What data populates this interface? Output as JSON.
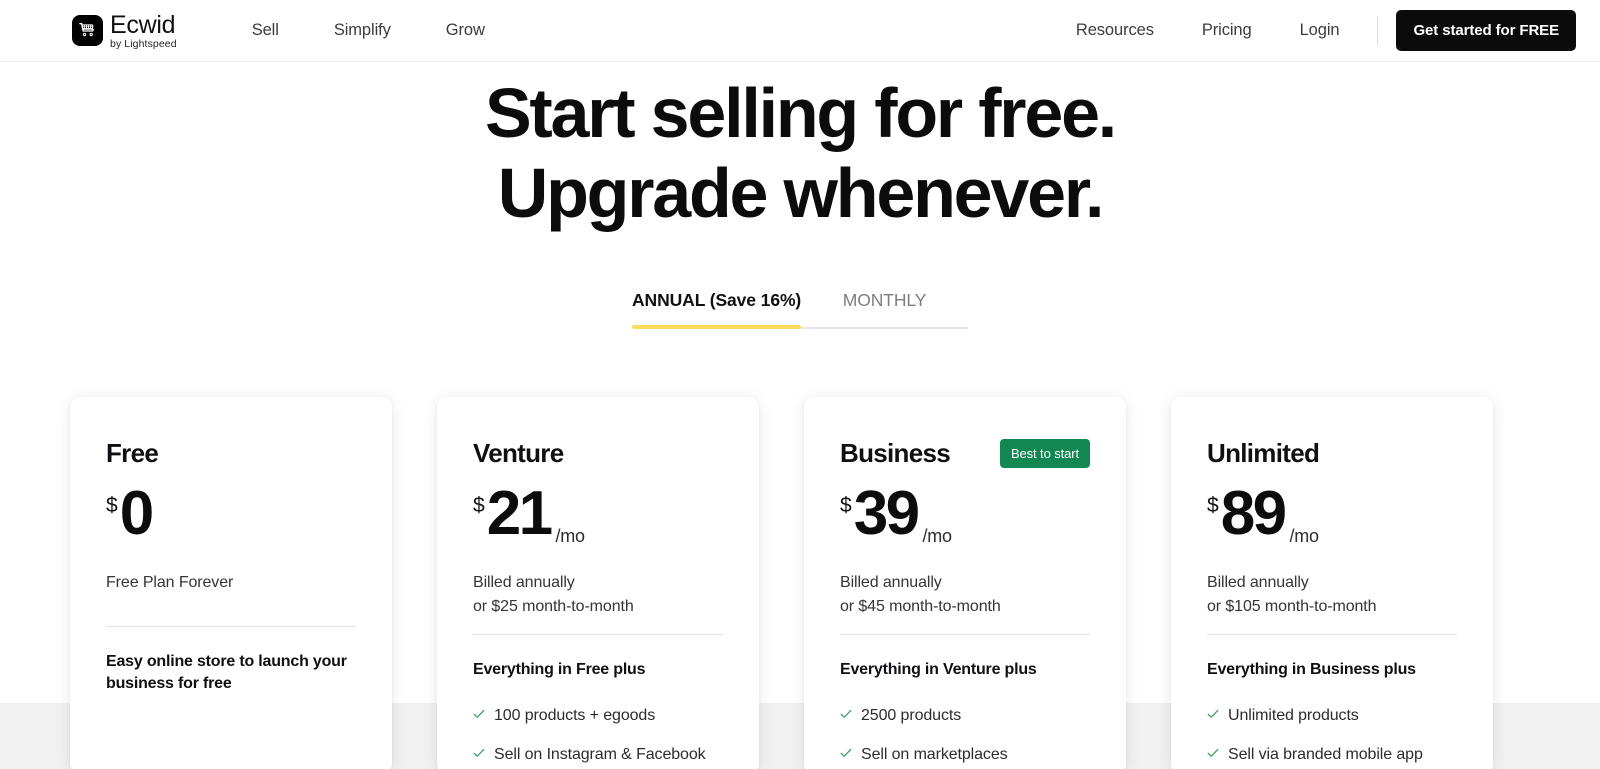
{
  "header": {
    "brand": {
      "icon": "shopping-cart-icon",
      "name": "Ecwid",
      "tagline": "by Lightspeed"
    },
    "nav_primary": [
      {
        "label": "Sell"
      },
      {
        "label": "Simplify"
      },
      {
        "label": "Grow"
      }
    ],
    "nav_right": [
      {
        "label": "Resources"
      },
      {
        "label": "Pricing"
      },
      {
        "label": "Login"
      }
    ],
    "cta_label": "Get started for FREE"
  },
  "hero": {
    "title_line1": "Start selling for free.",
    "title_line2": "Upgrade whenever."
  },
  "billing_toggle": {
    "tabs": [
      {
        "label": "ANNUAL (Save 16%)",
        "active": true
      },
      {
        "label": "MONTHLY",
        "active": false
      }
    ],
    "active_underline_color": "#fcdb5c",
    "inactive_underline_color": "#e6e6e8"
  },
  "plans": [
    {
      "name": "Free",
      "badge": "",
      "currency": "$",
      "amount": "0",
      "period": "",
      "billing_line1": "Free Plan Forever",
      "billing_line2": "",
      "subhead": "Easy online store to launch your business for free",
      "features": []
    },
    {
      "name": "Venture",
      "badge": "",
      "currency": "$",
      "amount": "21",
      "period": "/mo",
      "billing_line1": "Billed annually",
      "billing_line2": "or $25 month-to-month",
      "subhead": "Everything in Free plus",
      "features": [
        "100 products + egoods",
        "Sell on Instagram & Facebook"
      ]
    },
    {
      "name": "Business",
      "badge": "Best to start",
      "currency": "$",
      "amount": "39",
      "period": "/mo",
      "billing_line1": "Billed annually",
      "billing_line2": "or $45 month-to-month",
      "subhead": "Everything in Venture plus",
      "features": [
        "2500 products",
        "Sell on marketplaces"
      ]
    },
    {
      "name": "Unlimited",
      "badge": "",
      "currency": "$",
      "amount": "89",
      "period": "/mo",
      "billing_line1": "Billed annually",
      "billing_line2": "or $105 month-to-month",
      "subhead": "Everything in Business plus",
      "features": [
        "Unlimited products",
        "Sell via branded mobile app"
      ]
    }
  ],
  "colors": {
    "badge_green": "#128752",
    "check_green": "#3a9e63",
    "accent_yellow": "#fcdb5c",
    "cta_black": "#0b0b0b",
    "band_grey": "#f1f1f2"
  }
}
